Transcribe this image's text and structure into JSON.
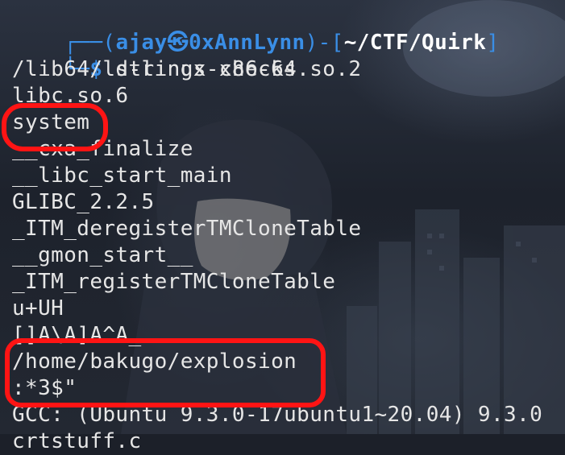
{
  "prompt": {
    "corner_top": "┌──",
    "user": "ajay",
    "at_symbol": "㉿",
    "host": "0xAnnLynn",
    "separator": ")-[",
    "open_paren": "(",
    "path": "~/CTF/Quirk",
    "close_bracket": "]",
    "corner_bottom": "└─",
    "dollar": "$",
    "command": "strings checks"
  },
  "output_lines": [
    "/lib64/ld-linux-x86-64.so.2",
    "libc.so.6",
    "system",
    "__cxa_finalize",
    "__libc_start_main",
    "GLIBC_2.2.5",
    "_ITM_deregisterTMCloneTable",
    "__gmon_start__",
    "_ITM_registerTMCloneTable",
    "u+UH",
    "[]A\\A]A^A_",
    "/home/bakugo/explosion",
    ":*3$\"",
    "GCC: (Ubuntu 9.3.0-17ubuntu1~20.04) 9.3.0",
    "crtstuff.c"
  ],
  "colors": {
    "accent": "#3a8ee6",
    "annotation": "#ff1414",
    "text": "#e6e6e6"
  }
}
